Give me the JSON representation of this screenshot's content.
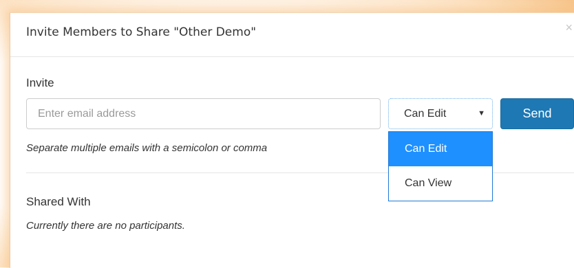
{
  "dialog": {
    "title": "Invite Members to Share \"Other Demo\"",
    "close_symbol": "×"
  },
  "invite": {
    "label": "Invite",
    "email_placeholder": "Enter email address",
    "email_value": "",
    "permission_selected": "Can Edit",
    "permission_caret": "▼",
    "permission_options": [
      "Can Edit",
      "Can View"
    ],
    "send_label": "Send",
    "hint": "Separate multiple emails with a semicolon or comma"
  },
  "shared": {
    "title": "Shared With",
    "empty_message": "Currently there are no participants."
  },
  "colors": {
    "primary_button": "#1e78b4",
    "dropdown_highlight": "#1e90ff",
    "glow": "#f7c48a"
  }
}
